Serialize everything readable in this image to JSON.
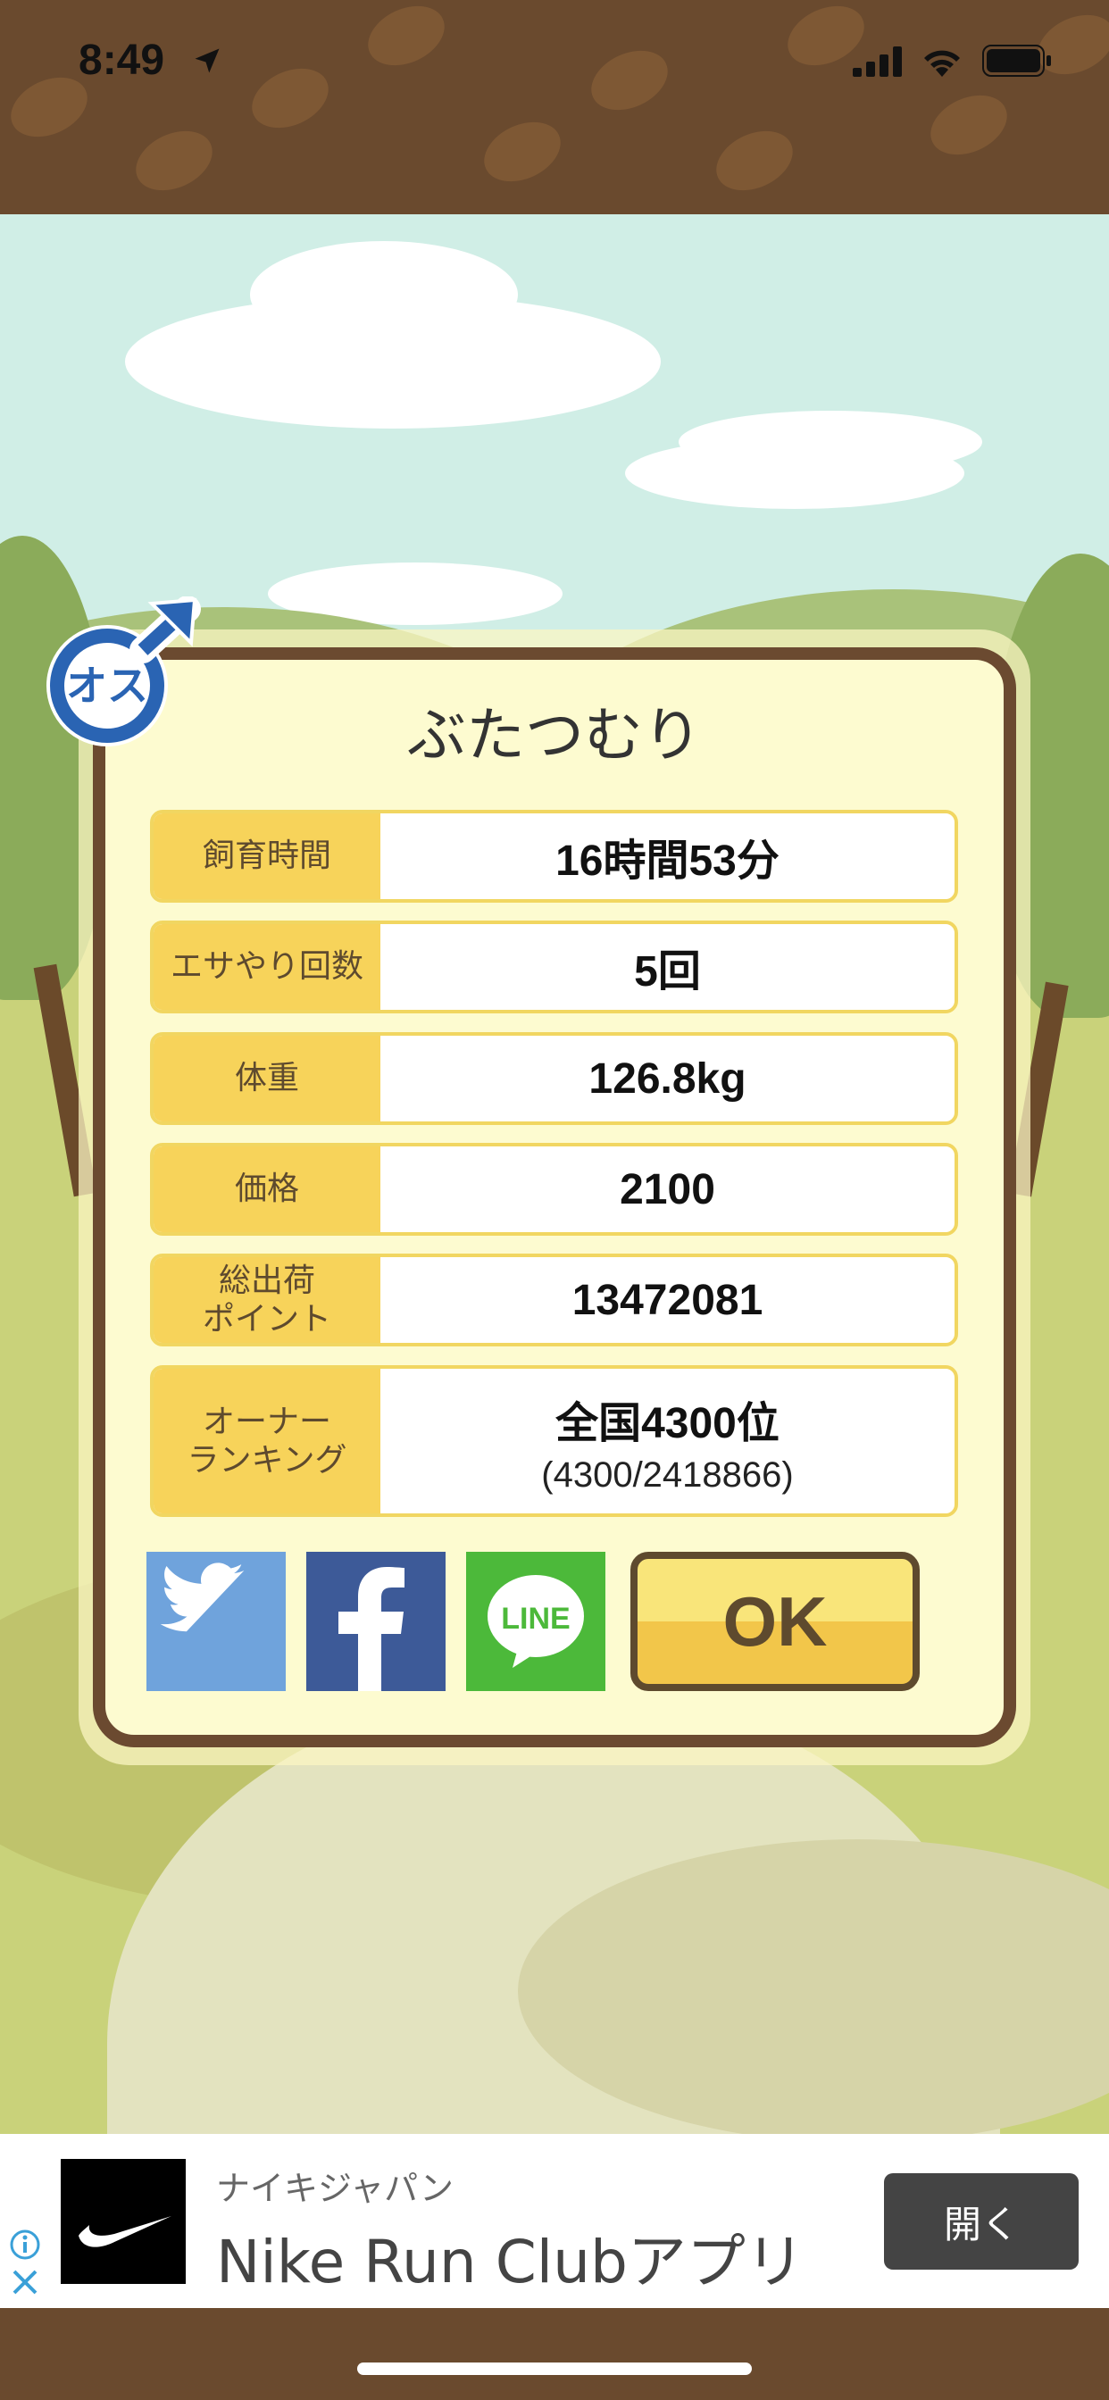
{
  "status": {
    "time": "8:49"
  },
  "card": {
    "title": "ぶたつむり",
    "rows": [
      {
        "label": "飼育時間",
        "value": "16時間53分"
      },
      {
        "label": "エサやり回数",
        "value": "5回"
      },
      {
        "label": "体重",
        "value": "126.8kg"
      },
      {
        "label": "価格",
        "value": "2100"
      },
      {
        "label": "総出荷\nポイント",
        "value": "13472081"
      }
    ],
    "ranking": {
      "label": "オーナー\nランキング",
      "value": "全国4300位",
      "detail": "(4300/2418866)"
    },
    "gender_badge": "オス",
    "ok_label": "OK"
  },
  "share": {
    "twitter_icon": "twitter-bird-icon",
    "facebook_icon": "facebook-f-icon",
    "line_label": "LINE"
  },
  "ad": {
    "brand": "ナイキジャパン",
    "title": "Nike Run Clubアプリ",
    "button": "開く"
  },
  "colors": {
    "card_border": "#6b4a30",
    "label_bg": "#f7d35a",
    "twitter": "#6fa3dc",
    "facebook": "#3d5a98",
    "line": "#4cb93a"
  }
}
